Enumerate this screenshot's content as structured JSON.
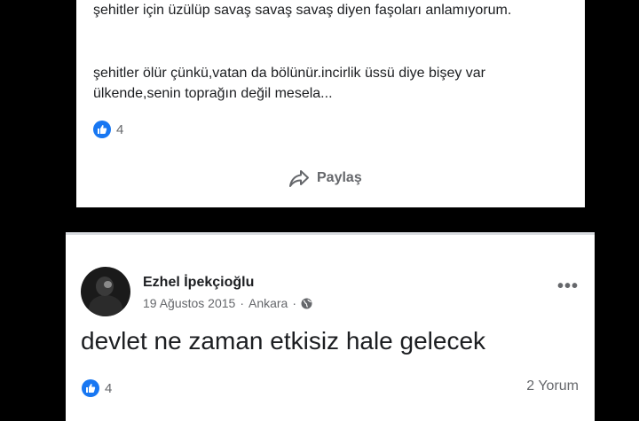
{
  "post1": {
    "paragraph1": "şehitler için üzülüp savaş savaş savaş diyen faşoları anlamıyorum.",
    "paragraph2": "şehitler ölür çünkü,vatan da bölünür.incirlik üssü diye bişey var ülkende,senin toprağın değil mesela...",
    "reaction_count": "4",
    "share_label": "Paylaş"
  },
  "post2": {
    "author": "Ezhel İpekçioğlu",
    "date": "19 Ağustos 2015",
    "location": "Ankara",
    "separator": "·",
    "text": "devlet ne zaman etkisiz hale gelecek",
    "reaction_count": "4",
    "comments": "2 Yorum",
    "more": "•••"
  },
  "icons": {
    "like": "thumbs-up-icon",
    "share": "share-arrow-icon",
    "privacy": "globe-icon",
    "more": "more-dots-icon"
  },
  "colors": {
    "like_blue": "#1877f2",
    "text": "#1c1e21",
    "secondary": "#65676b",
    "background": "#000000"
  }
}
